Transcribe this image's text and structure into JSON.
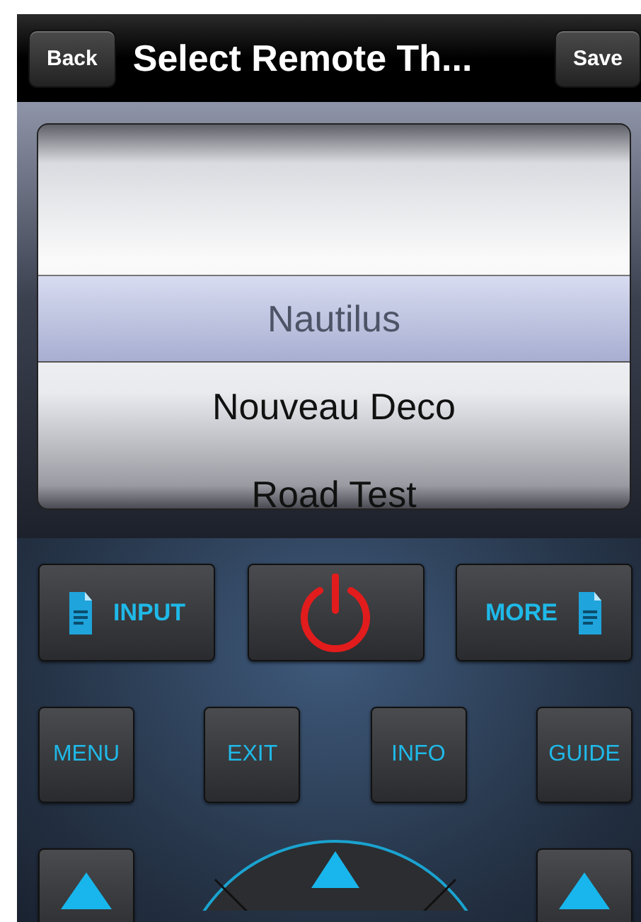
{
  "nav_bar": {
    "back": "Back",
    "title": "Select Remote Th...",
    "save": "Save"
  },
  "picker": {
    "items": [
      {
        "label": "Nautilus",
        "selected": true
      },
      {
        "label": "Nouveau Deco",
        "selected": false
      },
      {
        "label": "Road Test",
        "selected": false
      }
    ]
  },
  "remote": {
    "rows": [
      [
        {
          "kind": "doc-left",
          "label": "INPUT"
        },
        {
          "kind": "power"
        },
        {
          "kind": "doc-right",
          "label": "MORE"
        }
      ],
      [
        {
          "kind": "text",
          "label": "MENU"
        },
        {
          "kind": "text",
          "label": "EXIT"
        },
        {
          "kind": "text",
          "label": "INFO"
        },
        {
          "kind": "text",
          "label": "GUIDE"
        }
      ]
    ]
  }
}
